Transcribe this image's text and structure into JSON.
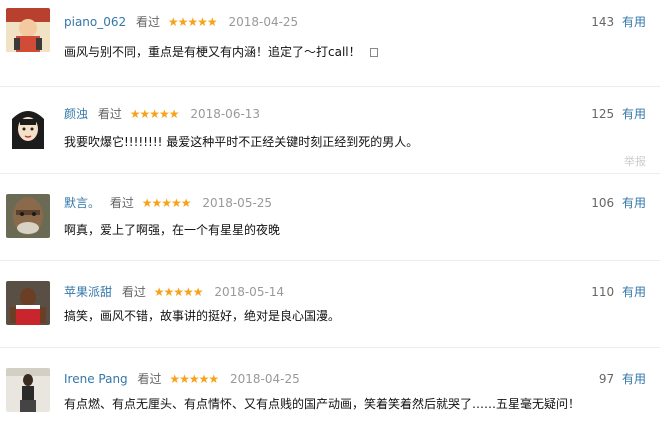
{
  "reviews": [
    {
      "username": "piano_062",
      "status": "看过",
      "stars": "★★★★★",
      "date": "2018-04-25",
      "votes": "143",
      "useful_label": "有用",
      "content": "画风与别不同，重点是有梗又有内涵！追定了～打call！",
      "report": ""
    },
    {
      "username": "颜浊",
      "status": "看过",
      "stars": "★★★★★",
      "date": "2018-06-13",
      "votes": "125",
      "useful_label": "有用",
      "content": "我要吹爆它!!!!!!!! 最爱这种平时不正经关键时刻正经到死的男人。",
      "report": "举报"
    },
    {
      "username": "默言。",
      "status": "看过",
      "stars": "★★★★★",
      "date": "2018-05-25",
      "votes": "106",
      "useful_label": "有用",
      "content": "啊真，爱上了啊强，在一个有星星的夜晚",
      "report": ""
    },
    {
      "username": "苹果派甜",
      "status": "看过",
      "stars": "★★★★★",
      "date": "2018-05-14",
      "votes": "110",
      "useful_label": "有用",
      "content": "搞笑，画风不错，故事讲的挺好，绝对是良心国漫。",
      "report": ""
    },
    {
      "username": "Irene Pang",
      "status": "看过",
      "stars": "★★★★★",
      "date": "2018-04-25",
      "votes": "97",
      "useful_label": "有用",
      "content": "有点燃、有点无厘头、有点情怀、又有点贱的国产动画，笑着笑着然后就哭了……五星毫无疑问！",
      "report": ""
    }
  ]
}
